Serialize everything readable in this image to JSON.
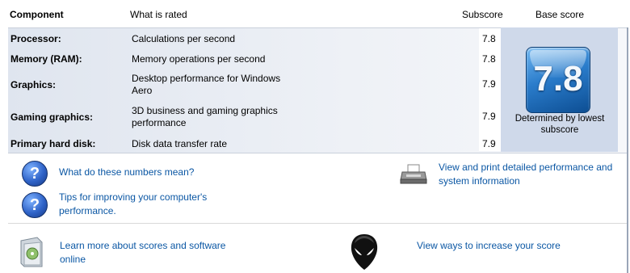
{
  "header": {
    "component": "Component",
    "what_is_rated": "What is rated",
    "subscore": "Subscore",
    "base_score": "Base score"
  },
  "rows": [
    {
      "label": "Processor:",
      "desc": "Calculations per second",
      "score": "7.8"
    },
    {
      "label": "Memory (RAM):",
      "desc": "Memory operations per second",
      "score": "7.8"
    },
    {
      "label": "Graphics:",
      "desc": "Desktop performance for Windows Aero",
      "score": "7.9"
    },
    {
      "label": "Gaming graphics:",
      "desc": "3D business and gaming graphics performance",
      "score": "7.9"
    },
    {
      "label": "Primary hard disk:",
      "desc": "Disk data transfer rate",
      "score": "7.9"
    }
  ],
  "base": {
    "score": "7.8",
    "caption": "Determined by lowest subscore"
  },
  "links": {
    "what_numbers": "What do these numbers mean?",
    "tips": "Tips for improving your computer's performance.",
    "view_print": "View and print detailed performance and system information",
    "learn_more": "Learn more about scores and software online",
    "view_ways": "View ways to increase your score"
  },
  "icons": {
    "help1": "help-icon",
    "help2": "help-icon",
    "printer": "printer-icon",
    "software": "software-box-icon",
    "alien": "alien-head-icon"
  }
}
